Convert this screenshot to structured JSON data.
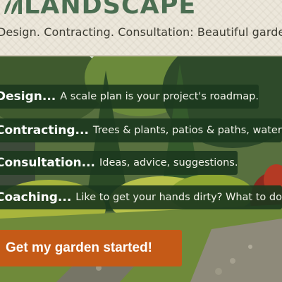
{
  "header": {
    "brand_title": "LANDSCAPE",
    "tagline": "Design. Contracting. Consultation: Beautiful gardens. Practical gardens.",
    "logo_icon": "leaf-logo-icon"
  },
  "hero": {
    "image_description_icon": "garden-photo",
    "services": [
      {
        "name": "Design...",
        "description": "A scale plan is your project's roadmap."
      },
      {
        "name": "Contracting...",
        "description": "Trees & plants, patios & paths, water features"
      },
      {
        "name": "Consultation...",
        "description": "Ideas, advice, suggestions."
      },
      {
        "name": "Coaching...",
        "description": "Like to get your hands dirty? What to do and how"
      }
    ],
    "cta_label": "Get my garden started!"
  },
  "colors": {
    "brand_green": "#4b6e52",
    "header_bg": "#ece7db",
    "card_bg": "#1c381e",
    "cta_orange": "#c55a17"
  }
}
